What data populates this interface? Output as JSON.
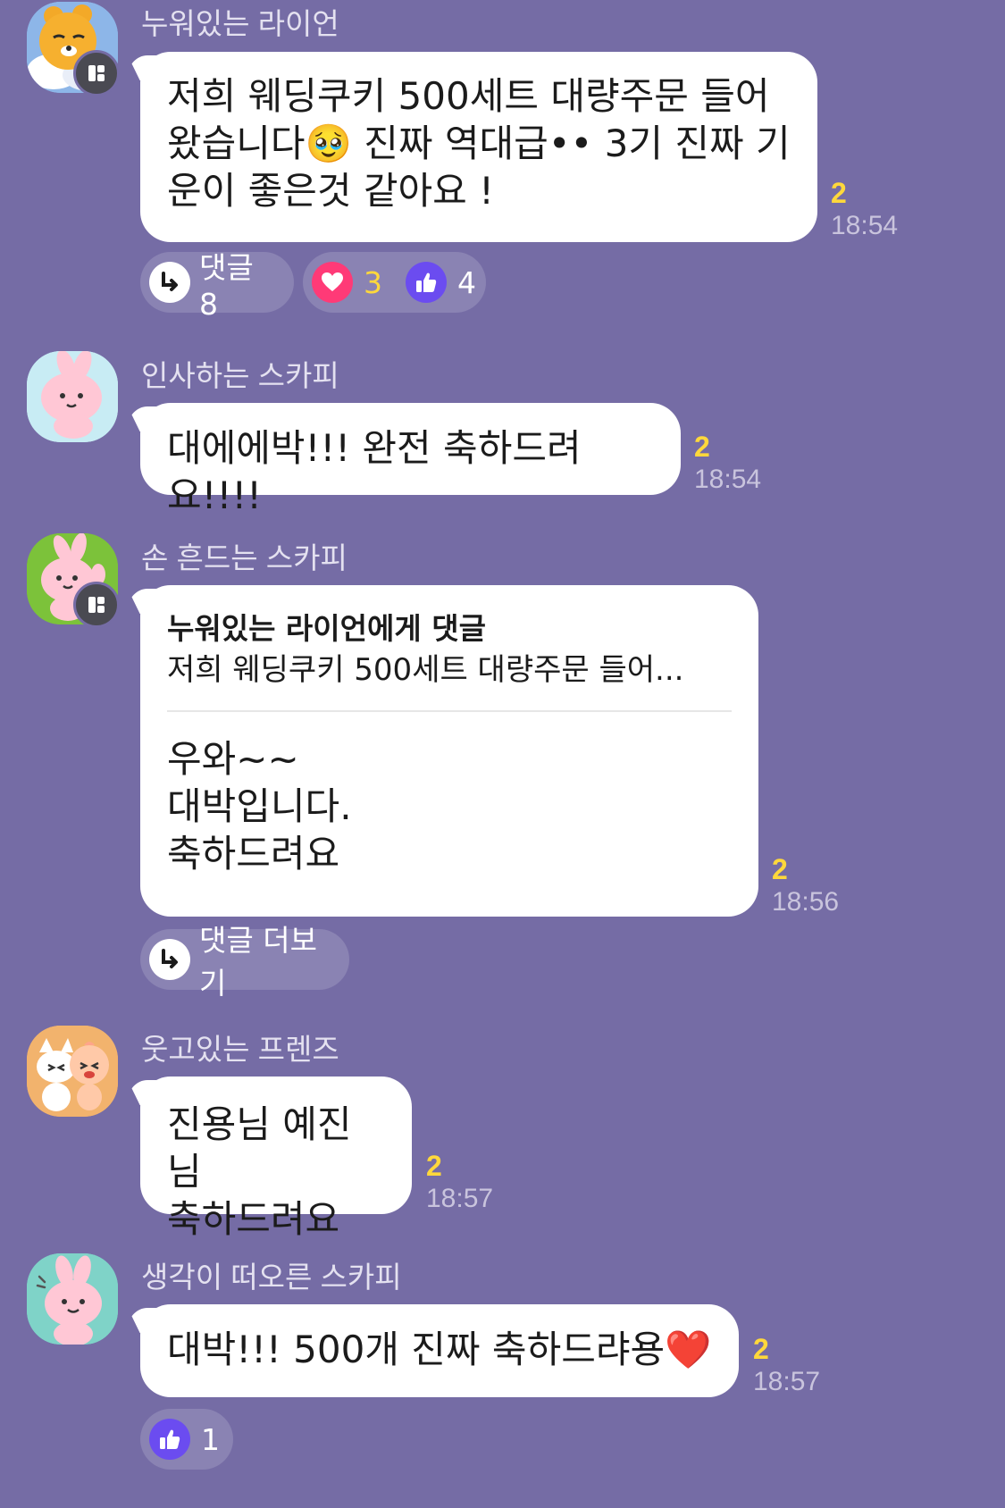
{
  "messages": [
    {
      "sender": "누워있는 라이언",
      "avatar_icon": "ryan-sleeping-icon",
      "avatar_bg": "#8db6e8",
      "has_badge": true,
      "text": "저희 웨딩쿠키 500세트 대량주문 들어\n왔습니다🥹 진짜 역대급•• 3기 진짜 기\n운이 좋은것 같아요 !",
      "unread": "2",
      "time": "18:54",
      "reply_label": "댓글 8",
      "heart_count": "3",
      "like_count": "4"
    },
    {
      "sender": "인사하는 스카피",
      "avatar_icon": "scarpy-greeting-icon",
      "avatar_bg": "#c8ecf4",
      "text": "대에에박!!! 완전 축하드려요!!!!",
      "unread": "2",
      "time": "18:54"
    },
    {
      "sender": "손 흔드는 스카피",
      "avatar_icon": "scarpy-waving-icon",
      "avatar_bg": "#7cc23a",
      "has_badge": true,
      "reply_to": "누워있는 라이언에게 댓글",
      "quote": "저희 웨딩쿠키 500세트 대량주문 들어...",
      "text": "우와~~\n대박입니다.\n축하드려요",
      "unread": "2",
      "time": "18:56",
      "more_replies_label": "댓글 더보기"
    },
    {
      "sender": "웃고있는 프렌즈",
      "avatar_icon": "friends-laughing-icon",
      "avatar_bg": "#f2b36d",
      "text": "진용님 예진님\n축하드려요",
      "unread": "2",
      "time": "18:57"
    },
    {
      "sender": "생각이 떠오른 스카피",
      "avatar_icon": "scarpy-idea-icon",
      "avatar_bg": "#7fd3c8",
      "text": "대박!!! 500개 진짜 축하드랴용❤️",
      "unread": "2",
      "time": "18:57",
      "like_count": "1"
    }
  ],
  "colors": {
    "background": "#756ca5",
    "unread": "#ffd83b",
    "heart": "#ff3a77",
    "like": "#6b4cf0"
  }
}
